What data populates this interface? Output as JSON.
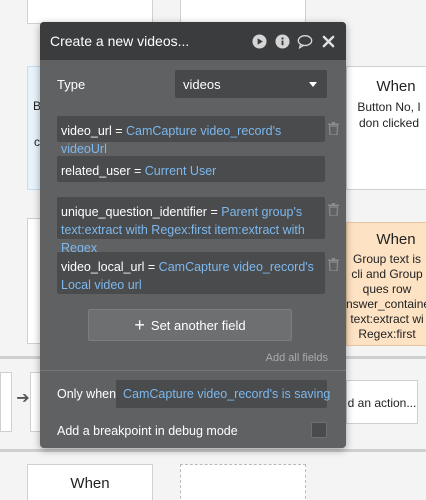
{
  "modal": {
    "title": "Create a new videos...",
    "type_label": "Type",
    "type_value": "videos",
    "fields": [
      {
        "key": "video_url",
        "op": "=",
        "value": "CamCapture video_record's videoUrl"
      },
      {
        "key": "related_user",
        "op": "=",
        "value": "Current User"
      },
      {
        "key": "unique_question_identifier",
        "op": "=",
        "value": "Parent group's text:extract with Regex:first item:extract with Regex"
      },
      {
        "key": "video_local_url",
        "op": "=",
        "value": "CamCapture video_record's Local video url"
      }
    ],
    "set_another_label": "Set another field",
    "add_all_label": "Add all fields",
    "only_when_label": "Only when",
    "only_when_value": "CamCapture video_record's is saving",
    "breakpoint_label": "Add a breakpoint in debug mode",
    "breakpoint_checked": false
  },
  "background": {
    "when_top_right": "When",
    "when_top_right_desc": "Button No, I don clicked",
    "when_mid_right": "When",
    "when_mid_right_desc": "Group text is cli and Group ques row nswer_containe text:extract wi Regex:first item:extract w",
    "action_text": "d an action...",
    "when_bottom_left": "When",
    "left_fragment_1": "B",
    "left_fragment_2": "c"
  },
  "colors": {
    "modal_bg": "#5f6163",
    "header_bg": "#3a3c3e",
    "field_bg": "#494b4d",
    "dynamic_value": "#7db8ee"
  },
  "icons": [
    "play-icon",
    "info-icon",
    "comment-icon",
    "close-icon",
    "trash-icon",
    "plus-icon",
    "arrow-right-icon",
    "caret-down-icon"
  ]
}
